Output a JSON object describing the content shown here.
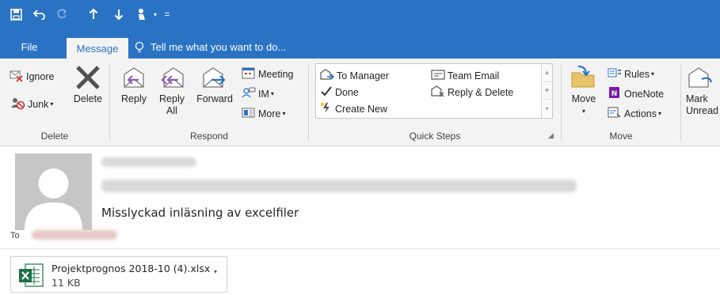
{
  "quick_access": {
    "save_icon": "save-icon",
    "undo_icon": "undo-icon",
    "redo_icon": "redo-icon",
    "up_icon": "arrow-up-icon",
    "down_icon": "arrow-down-icon",
    "touch_icon": "touch-mode-icon",
    "customize_icon": "customize-qat-icon"
  },
  "tabs": [
    {
      "label": "File"
    },
    {
      "label": "Message",
      "active": true
    }
  ],
  "tell_me": {
    "label": "Tell me what you want to do..."
  },
  "ribbon": {
    "delete_group": {
      "label": "Delete",
      "ignore": "Ignore",
      "junk": "Junk",
      "delete": "Delete"
    },
    "respond_group": {
      "label": "Respond",
      "reply": "Reply",
      "reply_all_1": "Reply",
      "reply_all_2": "All",
      "forward": "Forward",
      "meeting": "Meeting",
      "im": "IM",
      "more": "More"
    },
    "quick_steps_group": {
      "label": "Quick Steps",
      "items": [
        {
          "label": "To Manager"
        },
        {
          "label": "Done"
        },
        {
          "label": "Create New"
        },
        {
          "label": "Team Email"
        },
        {
          "label": "Reply & Delete"
        }
      ]
    },
    "move_group": {
      "label": "Move",
      "move": "Move",
      "rules": "Rules",
      "onenote": "OneNote",
      "actions": "Actions"
    },
    "tags_group": {
      "mark_1": "Mark",
      "mark_2": "Unread"
    }
  },
  "message": {
    "subject": "Misslyckad inläsning av excelfiler",
    "to_label": "To",
    "attachment": {
      "name": "Projektprognos 2018-10 (4).xlsx",
      "size": "11 KB"
    }
  },
  "colors": {
    "title_blue": "#2a73c4",
    "ribbon_bg": "#f3f3f3",
    "excel_green": "#1e7145"
  }
}
